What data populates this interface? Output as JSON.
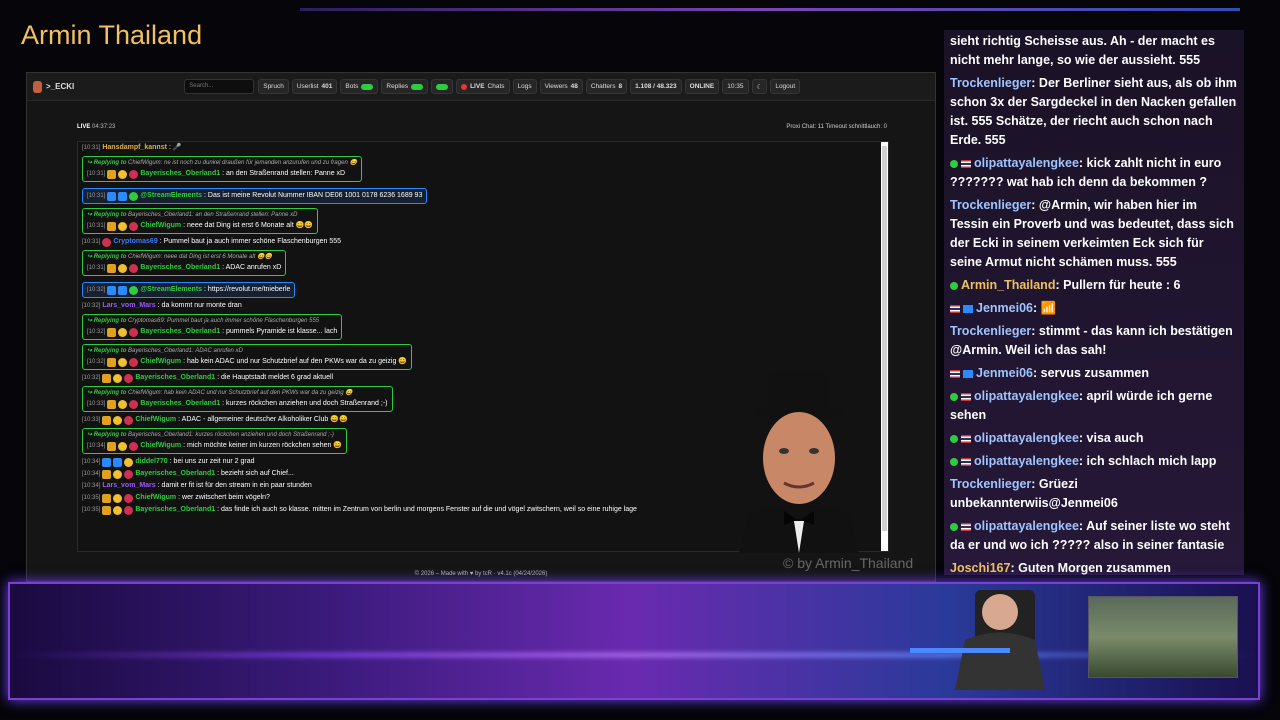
{
  "channel_title": "Armin Thailand",
  "browser": {
    "brand": ">_ECKI",
    "search_placeholder": "Search...",
    "nav": {
      "spruch": "Spruch",
      "userlist": "Userlist",
      "userlist_count": "401",
      "bots": "Bots",
      "replies": "Replies",
      "live": "LIVE",
      "chats": "Chats",
      "logs": "Logs",
      "viewers": "Viewers",
      "viewers_count": "48",
      "chatters": "Chatters",
      "chatters_count": "8",
      "messages": "1.108 / 48.323",
      "online": "ONLINE",
      "time": "10:35",
      "logout": "Logout"
    },
    "status": {
      "live_label": "LIVE",
      "duration": "04:37:23",
      "right": "Proxi Chat: 11  Timeout schnittlauch: 0"
    },
    "footer": "© 2026 – Made with ♥ by tcR · v4.1c (04/24/2026)",
    "watermark": "© by Armin_Thailand"
  },
  "messages": [
    {
      "ts": "[10:31]",
      "user": "Hansdampf_kannst",
      "color": "#e0b040",
      "text": ": 🎤",
      "reply": null,
      "badges": []
    },
    {
      "ts": "[10:31]",
      "user": "Bayerisches_Oberland1",
      "color": "#2ecc40",
      "text": ": an den Straßenrand stellen: Panne xD",
      "reply": {
        "to": "ChiefWigum",
        "text": "ne ist noch zu dunkel draußen für jemanden anzurufen und zu fragen 😄"
      },
      "badges": [
        "crown",
        "coin",
        "red"
      ]
    },
    {
      "ts": "[10:31]",
      "user": "@StreamElements",
      "color": "#2ecc40",
      "text": ": Das ist meine Revolut Nummer IBAN DE06 1001 0178 6236 1689 93",
      "reply": null,
      "se": true,
      "badges": [
        "mod",
        "mod",
        "check"
      ]
    },
    {
      "ts": "[10:31]",
      "user": "ChiefWigum",
      "color": "#2ecc40",
      "text": ": neee dat Ding ist erst 6 Monate alt 😄😄",
      "reply": {
        "to": "Bayerisches_Oberland1",
        "text": "an den Straßenrand stellen: Panne xD"
      },
      "badges": [
        "crown",
        "coin",
        "red"
      ]
    },
    {
      "ts": "[10:31]",
      "user": "Cryptomas69",
      "color": "#3a7aff",
      "text": ": Pummel baut ja auch immer schöne Flaschenburgen 555",
      "reply": null,
      "badges": [
        "red"
      ]
    },
    {
      "ts": "[10:31]",
      "user": "Bayerisches_Oberland1",
      "color": "#2ecc40",
      "text": ": ADAC anrufen xD",
      "reply": {
        "to": "ChiefWigum",
        "text": "neee dat Ding ist erst 6 Monate alt 😄😄"
      },
      "badges": [
        "crown",
        "coin",
        "red"
      ]
    },
    {
      "ts": "[10:32]",
      "user": "@StreamElements",
      "color": "#2ecc40",
      "text": ": https://revolut.me/tnieberle",
      "reply": null,
      "se": true,
      "badges": [
        "mod",
        "mod",
        "check"
      ]
    },
    {
      "ts": "[10:32]",
      "user": "Lars_vom_Mars",
      "color": "#9a5aff",
      "text": ": da kommt nur monte dran",
      "reply": null,
      "badges": []
    },
    {
      "ts": "[10:32]",
      "user": "Bayerisches_Oberland1",
      "color": "#2ecc40",
      "text": ": pummels Pyramide ist klasse... lach",
      "reply": {
        "to": "Cryptomas69",
        "text": "Pummel baut ja auch immer schöne Flaschenburgen 555"
      },
      "badges": [
        "crown",
        "coin",
        "red"
      ]
    },
    {
      "ts": "[10:32]",
      "user": "ChiefWigum",
      "color": "#2ecc40",
      "text": ": hab kein ADAC und nur Schutzbrief auf den PKWs war da zu geizig 😄",
      "reply": {
        "to": "Bayerisches_Oberland1",
        "text": "ADAC anrufen xD"
      },
      "badges": [
        "crown",
        "coin",
        "red"
      ]
    },
    {
      "ts": "[10:32]",
      "user": "Bayerisches_Oberland1",
      "color": "#2ecc40",
      "text": ": die Hauptstadt meldet 6 grad aktuell",
      "reply": null,
      "badges": [
        "crown",
        "coin",
        "red"
      ]
    },
    {
      "ts": "[10:33]",
      "user": "Bayerisches_Oberland1",
      "color": "#2ecc40",
      "text": ": kurzes röckchen anziehen und doch Straßenrand ;-)",
      "reply": {
        "to": "ChiefWigum",
        "text": "hab kein ADAC und nur Schutzbrief auf den PKWs war da zu geizig 😄"
      },
      "badges": [
        "crown",
        "coin",
        "red"
      ]
    },
    {
      "ts": "[10:33]",
      "user": "ChiefWigum",
      "color": "#2ecc40",
      "text": ": ADAC - allgemeiner deutscher Alkoholiker Club 😄😄",
      "reply": null,
      "badges": [
        "crown",
        "coin",
        "red"
      ]
    },
    {
      "ts": "[10:34]",
      "user": "ChiefWigum",
      "color": "#2ecc40",
      "text": ": mich möchte keiner im kurzen röckchen sehen 😄",
      "reply": {
        "to": "Bayerisches_Oberland1",
        "text": "kurzes röckchen anziehen und doch Straßenrand ;-)"
      },
      "badges": [
        "crown",
        "coin",
        "red"
      ]
    },
    {
      "ts": "[10:34]",
      "user": "diddel770",
      "color": "#2ecc40",
      "text": ": bei uns zur zeit nur 2 grad",
      "reply": null,
      "badges": [
        "mod",
        "mod",
        "coin"
      ]
    },
    {
      "ts": "[10:34]",
      "user": "Bayerisches_Oberland1",
      "color": "#2ecc40",
      "text": ": bezieht sich auf Chief...",
      "reply": null,
      "badges": [
        "crown",
        "coin",
        "red"
      ]
    },
    {
      "ts": "[10:34]",
      "user": "Lars_vom_Mars",
      "color": "#9a5aff",
      "text": ": damit er fit ist für den stream in ein paar stunden",
      "reply": null,
      "badges": []
    },
    {
      "ts": "[10:35]",
      "user": "ChiefWigum",
      "color": "#2ecc40",
      "text": ": wer zwitschert beim vögeln?",
      "reply": null,
      "badges": [
        "crown",
        "coin",
        "red"
      ]
    },
    {
      "ts": "[10:35]",
      "user": "Bayerisches_Oberland1",
      "color": "#2ecc40",
      "text": ": das finde ich auch so klasse. mitten im Zentrum von berlin und morgens Fenster auf die und vögel zwitschern, weil so eine ruhige lage",
      "reply": null,
      "badges": [
        "crown",
        "coin",
        "red"
      ]
    }
  ],
  "side_chat": [
    {
      "icon": "",
      "name": "",
      "name_class": "",
      "text": "sieht richtig Scheisse aus. Ah - der macht es nicht mehr lange, so wie der aussieht. 555"
    },
    {
      "icon": "",
      "name": "Trockenlieger",
      "name_class": "name-blue",
      "text": ": Der Berliner sieht aus, als ob ihm schon 3x der Sargdeckel in den Nacken gefallen ist. 555 Schätze, der riecht auch schon nach Erde. 555"
    },
    {
      "icon": "green-thai",
      "name": "olipattayalengkee",
      "name_class": "name-blue",
      "text": ": kick zahlt nicht in euro ??????? wat hab ich denn da bekommen ?"
    },
    {
      "icon": "",
      "name": "Trockenlieger",
      "name_class": "name-blue",
      "text": ": @Armin, wir haben hier im Tessin ein Proverb und was bedeutet, dass sich der Ecki in seinem verkeimten Eck sich für seine Armut nicht schämen muss. 555"
    },
    {
      "icon": "green",
      "name": "Armin_Thailand",
      "name_class": "name-gold",
      "text": ": Pullern für heute : 6"
    },
    {
      "icon": "thai-blue",
      "name": "Jenmei06",
      "name_class": "name-blue",
      "text": ": 📶"
    },
    {
      "icon": "",
      "name": "Trockenlieger",
      "name_class": "name-blue",
      "text": ": stimmt - das kann ich bestätigen @Armin. Weil ich das sah!"
    },
    {
      "icon": "thai-blue",
      "name": "Jenmei06",
      "name_class": "name-blue",
      "text": ": servus zusammen"
    },
    {
      "icon": "green-thai",
      "name": "olipattayalengkee",
      "name_class": "name-blue",
      "text": ": april würde ich gerne sehen"
    },
    {
      "icon": "green-thai",
      "name": "olipattayalengkee",
      "name_class": "name-blue",
      "text": ": visa auch"
    },
    {
      "icon": "green-thai",
      "name": "olipattayalengkee",
      "name_class": "name-blue",
      "text": ": ich schlach mich lapp"
    },
    {
      "icon": "",
      "name": "Trockenlieger",
      "name_class": "name-blue",
      "text": ": Grüezi unbekannterwiis@Jenmei06"
    },
    {
      "icon": "green-thai",
      "name": "olipattayalengkee",
      "name_class": "name-blue",
      "text": ": Auf seiner liste wo steht da er und wo ich ????? also in seiner fantasie"
    },
    {
      "icon": "",
      "name": "Joschi167",
      "name_class": "name-gold",
      "text": ": Guten Morgen zusammen"
    }
  ]
}
